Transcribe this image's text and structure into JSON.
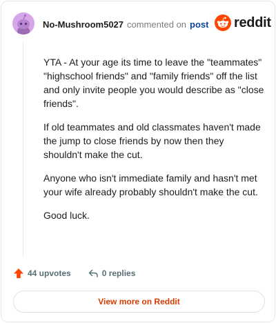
{
  "author": {
    "username": "No-Mushroom5027",
    "avatar_icon": "snoo-avatar-icon"
  },
  "header": {
    "commented_text": "commented on",
    "post_link": "post"
  },
  "brand": {
    "name": "reddit",
    "logo_icon": "reddit-snoo-icon",
    "accent_color": "#ff4500"
  },
  "comment": {
    "paragraphs": [
      "YTA - At your age its time to leave the \"teammates\" \"highschool friends\" and \"family friends\" off the list and only invite people you would describe as \"close friends\".",
      "If old teammates and old classmates haven't made the jump to close friends by now then they shouldn't make the cut.",
      "Anyone who isn't immediate family and hasn't met your wife already probably shouldn't make the cut.",
      "Good luck."
    ]
  },
  "actions": {
    "upvotes": "44 upvotes",
    "upvote_icon": "upvote-arrow-icon",
    "replies": "0 replies",
    "reply_icon": "reply-arrow-icon"
  },
  "footer": {
    "view_more_label": "View more on Reddit"
  }
}
